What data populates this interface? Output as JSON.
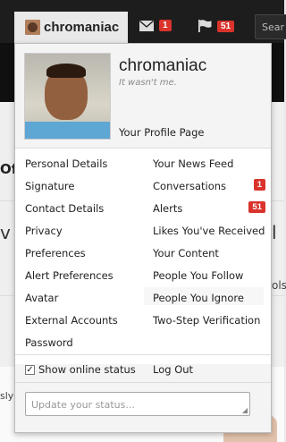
{
  "nav": {
    "username": "chromaniac",
    "inbox_count": "1",
    "alerts_count": "51",
    "search_placeholder": "Sear"
  },
  "background": {
    "frag_off": "Off",
    "frag_v": "v",
    "frag_l": "l",
    "frag_ols": "ols",
    "frag_sly": "sly"
  },
  "profile": {
    "name": "chromaniac",
    "status": "It wasn't me.",
    "profile_page": "Your Profile Page"
  },
  "menu": {
    "left": [
      "Personal Details",
      "Signature",
      "Contact Details",
      "Privacy",
      "Preferences",
      "Alert Preferences",
      "Avatar",
      "External Accounts",
      "Password"
    ],
    "right": [
      "Your News Feed",
      "Conversations",
      "Alerts",
      "Likes You've Received",
      "Your Content",
      "People You Follow",
      "People You Ignore",
      "Two-Step Verification"
    ],
    "conversations_badge": "1",
    "alerts_badge": "51"
  },
  "footer": {
    "show_online_status": "Show online status",
    "show_online_checked": true,
    "logout": "Log Out",
    "status_placeholder": "Update your status..."
  },
  "colors": {
    "badge": "#d9332b",
    "topbar": "#1d1d1d",
    "popup_header": "#f4f4f4"
  }
}
